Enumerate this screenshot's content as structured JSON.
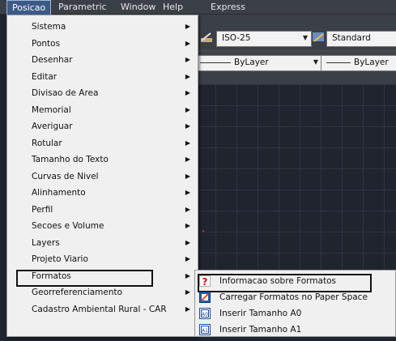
{
  "menubar": {
    "items": [
      "Posicao",
      "Parametric",
      "Window",
      "Help",
      "Express"
    ]
  },
  "toolbar": {
    "dimstyle": "ISO-25",
    "tablestyle": "Standard",
    "linetype": "ByLayer",
    "lineweight": "ByLayer"
  },
  "menu": {
    "items": [
      "Sistema",
      "Pontos",
      "Desenhar",
      "Editar",
      "Divisao de Area",
      "Memorial",
      "Averiguar",
      "Rotular",
      "Tamanho do Texto",
      "Curvas de Nivel",
      "Alinhamento",
      "Perfil",
      "Secoes e Volume",
      "Layers",
      "Projeto Viario",
      "Formatos",
      "Georreferenciamento",
      "Cadastro Ambiental Rural - CAR"
    ]
  },
  "submenu": {
    "items": [
      {
        "label": "Informacao sobre Formatos",
        "icon": "question-icon"
      },
      {
        "label": "Carregar Formatos no Paper Space",
        "icon": "paper-space-icon"
      },
      {
        "label": "Inserir Tamanho A0",
        "icon": "sheet-a0-icon"
      },
      {
        "label": "Inserir Tamanho A1",
        "icon": "sheet-a1-icon"
      }
    ]
  }
}
